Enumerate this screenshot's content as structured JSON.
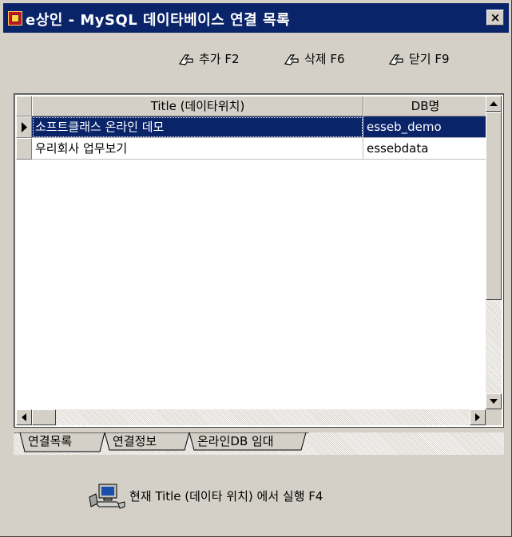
{
  "window": {
    "title": "e상인 - MySQL 데이타베이스 연결 목록",
    "close_label": "×"
  },
  "toolbar": {
    "buttons": [
      {
        "label": "추가 F2"
      },
      {
        "label": "삭제 F6"
      },
      {
        "label": "닫기 F9"
      }
    ]
  },
  "grid": {
    "columns": [
      "Title (데이타위치)",
      "DB명"
    ],
    "rows": [
      {
        "title": "소프트클래스 온라인 데모",
        "db": "esseb_demo",
        "selected": true
      },
      {
        "title": "우리회사 업무보기",
        "db": "essebdata",
        "selected": false
      }
    ]
  },
  "tabs": [
    {
      "label": "연결목록",
      "active": true
    },
    {
      "label": "연결정보",
      "active": false
    },
    {
      "label": "온라인DB 임대",
      "active": false
    }
  ],
  "run": {
    "label": "현재 Title (데이타 위치) 에서  실행 F4"
  },
  "colors": {
    "titlebar": "#0a246a",
    "selection": "#0a246a",
    "face": "#d4d0c8"
  }
}
